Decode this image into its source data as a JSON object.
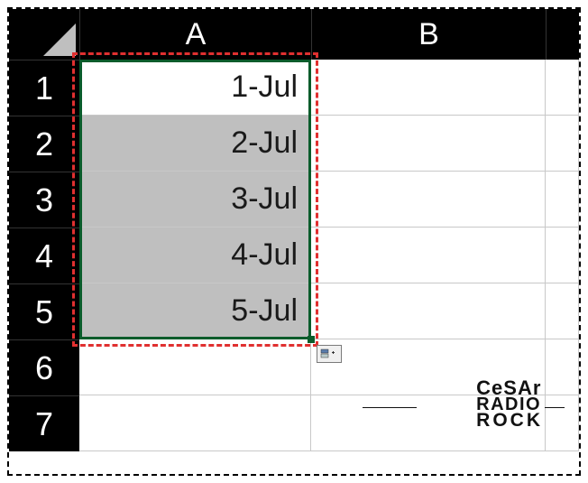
{
  "columns": [
    "A",
    "B"
  ],
  "rows": [
    "1",
    "2",
    "3",
    "4",
    "5",
    "6",
    "7"
  ],
  "cells": {
    "A1": "1-Jul",
    "A2": "2-Jul",
    "A3": "3-Jul",
    "A4": "4-Jul",
    "A5": "5-Jul"
  },
  "selection": {
    "range": "A1:A5",
    "active": "A1"
  },
  "watermark": {
    "line1": "CeSAr",
    "line2": "RADIO",
    "line3": "ROCK"
  }
}
